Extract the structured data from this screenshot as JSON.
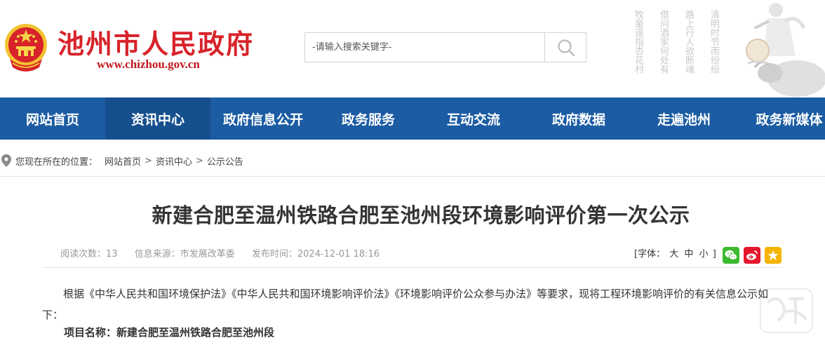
{
  "header": {
    "site_name": "池州市人民政府",
    "site_url": "www.chizhou.gov.cn",
    "poem_columns": [
      "清明时节雨纷纷",
      "路上行人欲断魂",
      "借问酒家何处有",
      "牧童遥指杏花村"
    ]
  },
  "search": {
    "placeholder": "-请输入搜索关键字-",
    "icon": "search-icon"
  },
  "nav": {
    "items": [
      "网站首页",
      "资讯中心",
      "政府信息公开",
      "政务服务",
      "互动交流",
      "政府数据",
      "走遍池州",
      "政务新媒体"
    ],
    "active_index": 1
  },
  "breadcrumb": {
    "prefix": "您现在所在的位置：",
    "items": [
      "网站首页",
      "资讯中心",
      "公示公告"
    ],
    "separator": ">",
    "icon": "location-pin-icon"
  },
  "article": {
    "title": "新建合肥至温州铁路合肥至池州段环境影响评价第一次公示",
    "views_label": "阅读次数：",
    "views": "13",
    "source_label": "信息来源：",
    "source": "市发展改革委",
    "date_label": "发布时间：",
    "date": "2024-12-01 18:16",
    "font_label_open": "[字体：",
    "font_sizes": [
      "大",
      "中",
      "小"
    ],
    "font_label_close": "]",
    "paragraph": "根据《中华人民共和国环境保护法》《中华人民共和国环境影响评价法》《环境影响评价公众参与办法》等要求，现将工程环境影响评价的有关信息公示如下：",
    "project_label": "项目名称：",
    "project_name": "新建合肥至温州铁路合肥至池州段"
  },
  "share": {
    "icons": [
      "wechat-icon",
      "weibo-icon",
      "favorite-star-icon"
    ],
    "colors": {
      "wechat": "#3dbb2f",
      "weibo": "#e6162d",
      "favorite": "#f5b400"
    }
  },
  "colors": {
    "brand_red": "#d8232a",
    "nav_blue": "#1b5ca3",
    "nav_active": "#164f8e"
  }
}
